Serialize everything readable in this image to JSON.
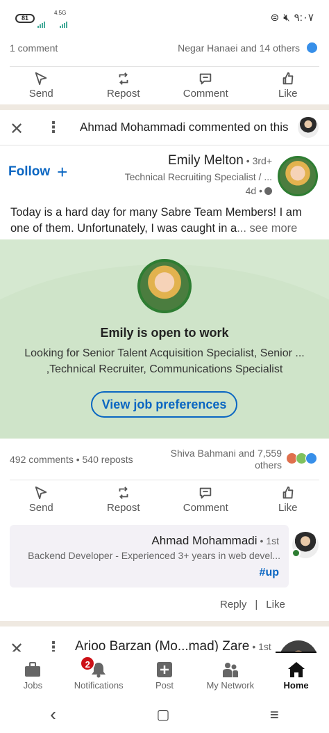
{
  "status_bar": {
    "battery": "81",
    "network_type": "4.5G",
    "clock": "۹:۰۷"
  },
  "prev_post": {
    "comment_count": "1 comment",
    "reactors": "Negar Hanaei and 14 others"
  },
  "actions": {
    "send": "Send",
    "repost": "Repost",
    "comment": "Comment",
    "like": "Like"
  },
  "post": {
    "context_text": "Ahmad Mohammadi commented on this",
    "follow_label": "Follow",
    "author_name": "Emily Melton",
    "degree": "• 3rd+",
    "headline": "Technical Recruiting Specialist / ...",
    "time": "4d •",
    "text": "Today is a hard day for many Sabre Team Members! I am one of them. Unfortunately, I was caught in a",
    "see_more": "... see more",
    "open_to_work": {
      "title": "Emily is open to work",
      "description": "Looking for Senior Talent Acquisition Specialist, Senior ... ,Technical Recruiter, Communications Specialist",
      "button": "View job preferences"
    },
    "counts": "492 comments • 540 reposts",
    "reactors_line1": "Shiva Bahmani and 7,559",
    "reactors_line2": "others"
  },
  "comment": {
    "author": "Ahmad Mohammadi",
    "degree": "• 1st",
    "headline": "Backend Developer - Experienced 3+ years in web devel...",
    "text": "#up",
    "reply_label": "Reply",
    "separator": "|",
    "like_label": "Like"
  },
  "next_post": {
    "author": "Arioo Barzan (Mo...mad) Zare",
    "degree": "• 1st"
  },
  "bottom_nav": {
    "jobs": "Jobs",
    "notifications": "Notifications",
    "notifications_badge": "2",
    "post": "Post",
    "my_network": "My Network",
    "home": "Home"
  },
  "system_nav": {
    "back": "‹",
    "home": "▢",
    "recents": "≡"
  },
  "colors": {
    "brand_blue": "#0a66c2",
    "open_to_work_green": "#2e7d32",
    "open_to_work_bg": "#d5e8d0",
    "badge_red": "#cc1016"
  }
}
